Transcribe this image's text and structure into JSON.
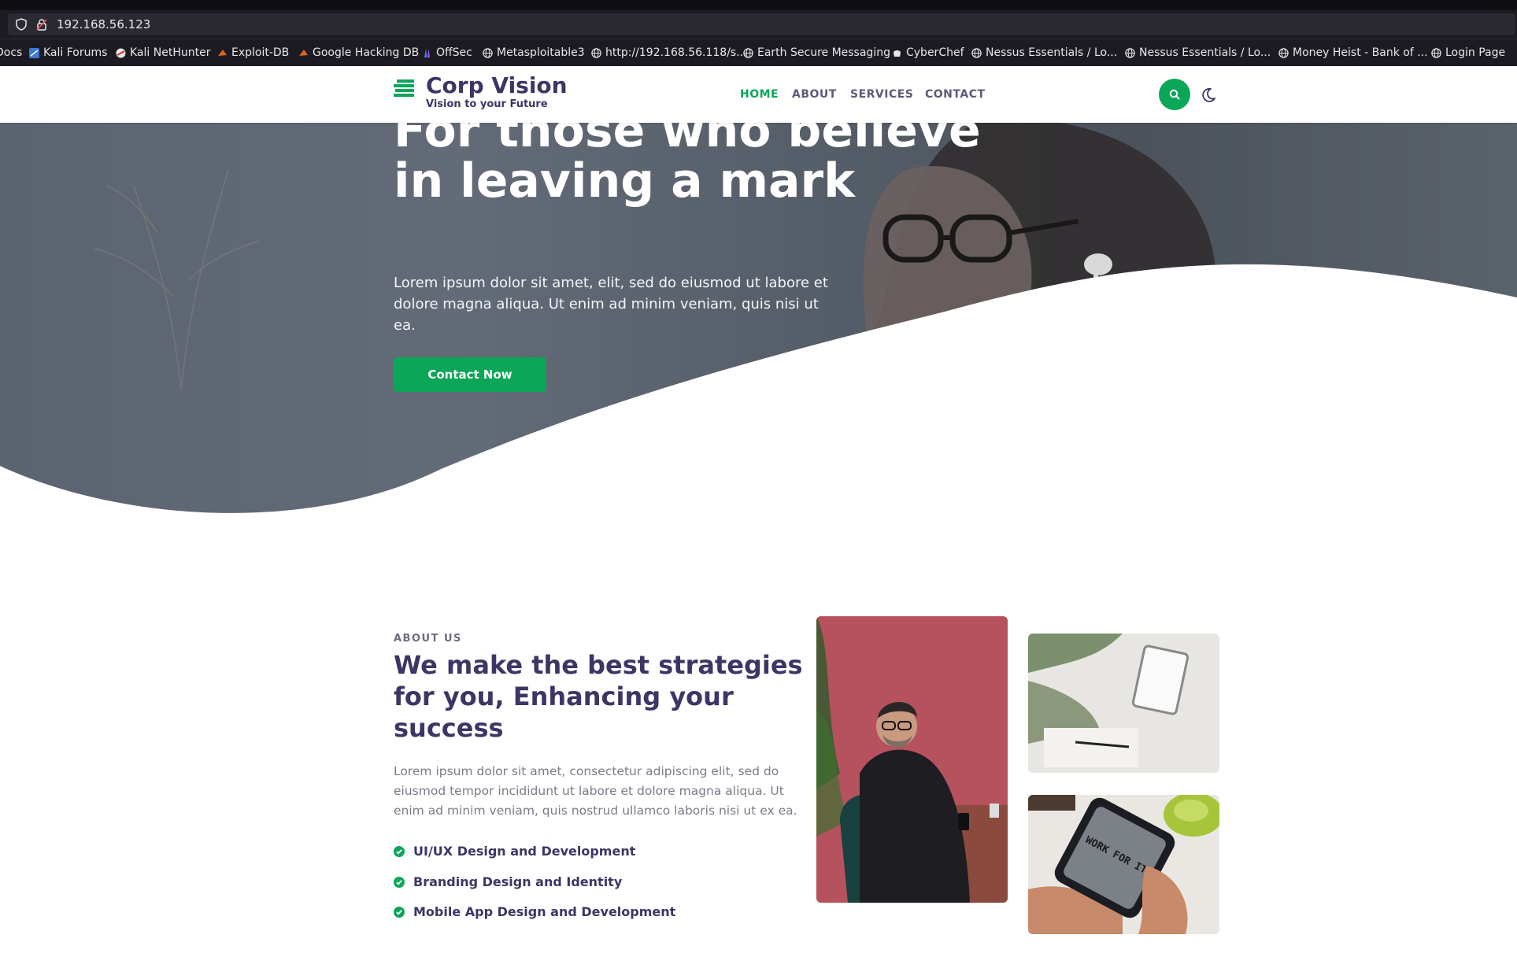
{
  "browser": {
    "url": "192.168.56.123",
    "bookmarks": [
      {
        "label": "Docs",
        "icon": "doc-icon"
      },
      {
        "label": "Kali Forums",
        "icon": "kali-icon"
      },
      {
        "label": "Kali NetHunter",
        "icon": "nethunter-icon"
      },
      {
        "label": "Exploit-DB",
        "icon": "exploitdb-icon"
      },
      {
        "label": "Google Hacking DB",
        "icon": "ghdb-icon"
      },
      {
        "label": "OffSec",
        "icon": "offsec-icon"
      },
      {
        "label": "Metasploitable3",
        "icon": "globe-icon"
      },
      {
        "label": "http://192.168.56.118/s...",
        "icon": "globe-icon"
      },
      {
        "label": "Earth Secure Messaging",
        "icon": "globe-icon"
      },
      {
        "label": "CyberChef",
        "icon": "cyberchef-icon"
      },
      {
        "label": "Nessus Essentials / Lo...",
        "icon": "globe-icon"
      },
      {
        "label": "Nessus Essentials / Lo...",
        "icon": "globe-icon"
      },
      {
        "label": "Money Heist - Bank of ...",
        "icon": "globe-icon"
      },
      {
        "label": "Login Page",
        "icon": "globe-icon"
      }
    ]
  },
  "header": {
    "brand": "Corp Vision",
    "tagline": "Vision to your Future",
    "nav": [
      "HOME",
      "ABOUT",
      "SERVICES",
      "CONTACT"
    ],
    "active_nav": "HOME"
  },
  "hero": {
    "title": "For those who believe in leaving a mark",
    "text": "Lorem ipsum dolor sit amet, elit, sed do eiusmod ut labore et dolore magna aliqua. Ut enim ad minim veniam, quis nisi ut ea.",
    "button": "Contact Now"
  },
  "about": {
    "kicker": "ABOUT US",
    "title": "We make the best strategies for you, Enhancing your success",
    "text": "Lorem ipsum dolor sit amet, consectetur adipiscing elit, sed do eiusmod tempor incididunt ut labore et dolore magna aliqua. Ut enim ad minim veniam, quis nostrud ullamco laboris nisi ut ex ea.",
    "features": [
      "UI/UX Design and Development",
      "Branding Design and Identity",
      "Mobile App Design and Development"
    ],
    "phone_screen_text": "WORK FOR IT"
  },
  "colors": {
    "accent": "#0ca659",
    "heading": "#3b3664",
    "chrome": "#1c1b22"
  }
}
